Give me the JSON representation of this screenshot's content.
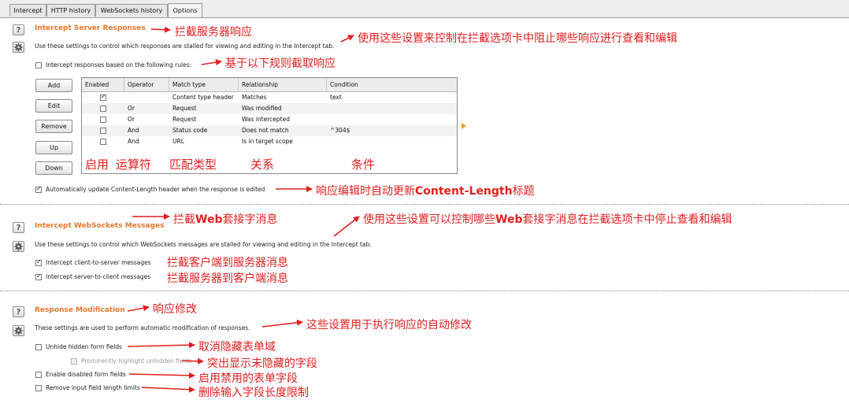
{
  "tabs": [
    {
      "label": "Intercept"
    },
    {
      "label": "HTTP history"
    },
    {
      "label": "WebSockets history"
    },
    {
      "label": "Options",
      "active": true
    }
  ],
  "server": {
    "title": "Intercept Server Responses",
    "desc": "Use these settings to control which responses are stalled for viewing and editing in the Intercept tab.",
    "rules_label": "Intercept responses based on the following rules:",
    "buttons": [
      "Add",
      "Edit",
      "Remove",
      "Up",
      "Down"
    ],
    "columns": [
      "Enabled",
      "Operator",
      "Match type",
      "Relationship",
      "Condition"
    ],
    "rows": [
      {
        "enabled": true,
        "operator": "",
        "match": "Content type header",
        "rel": "Matches",
        "cond": "text"
      },
      {
        "enabled": false,
        "operator": "Or",
        "match": "Request",
        "rel": "Was modified",
        "cond": ""
      },
      {
        "enabled": false,
        "operator": "Or",
        "match": "Request",
        "rel": "Was intercepted",
        "cond": ""
      },
      {
        "enabled": false,
        "operator": "And",
        "match": "Status code",
        "rel": "Does not match",
        "cond": "^304$"
      },
      {
        "enabled": false,
        "operator": "And",
        "match": "URL",
        "rel": "Is in target scope",
        "cond": ""
      }
    ],
    "auto_update_label": "Automatically update Content-Length header when the response is edited"
  },
  "websockets": {
    "title": "Intercept WebSockets Messages",
    "desc": "Use these settings to control which WebSockets messages are stalled for viewing and editing in the Intercept tab.",
    "client_to_server": "Intercept client-to-server messages",
    "server_to_client": "Intercept server-to-client messages"
  },
  "modification": {
    "title": "Response Modification",
    "desc": "These settings are used to perform automatic modification of responses.",
    "unhide": "Unhide hidden form fields",
    "highlight": "Prominently highlight unhidden fields",
    "enable_disabled": "Enable disabled form fields",
    "remove_limits": "Remove input field length limits"
  },
  "annotations": {
    "server_title": "拦截服务器响应",
    "server_desc": "使用这些设置来控制在拦截选项卡中阻止哪些响应进行查看和编辑",
    "rules": "基于以下规则截取响应",
    "col_enabled": "启用",
    "col_operator": "运算符",
    "col_match": "匹配类型",
    "col_rel": "关系",
    "col_cond": "条件",
    "auto_update_prefix": "响应编辑时自动更新",
    "auto_update_bold": "Content-Length",
    "auto_update_suffix": "标题",
    "ws_title_prefix": "拦截",
    "ws_title_bold": "Web",
    "ws_title_suffix": "套接字消息",
    "ws_desc_prefix": "使用这些设置可以控制哪些",
    "ws_desc_bold": "Web",
    "ws_desc_suffix": "套接字消息在拦截选项卡中停止查看和编辑",
    "ws_c2s": "拦截客户端到服务器消息",
    "ws_s2c": "拦截服务器到客户端消息",
    "mod_title": "响应修改",
    "mod_desc": "这些设置用于执行响应的自动修改",
    "unhide": "取消隐藏表单域",
    "highlight": "突出显示未隐藏的字段",
    "enable_disabled": "启用禁用的表单字段",
    "remove_limits": "删除输入字段长度限制"
  },
  "colors": {
    "section_title": "#e8772d",
    "annotation": "#e31e1e"
  }
}
